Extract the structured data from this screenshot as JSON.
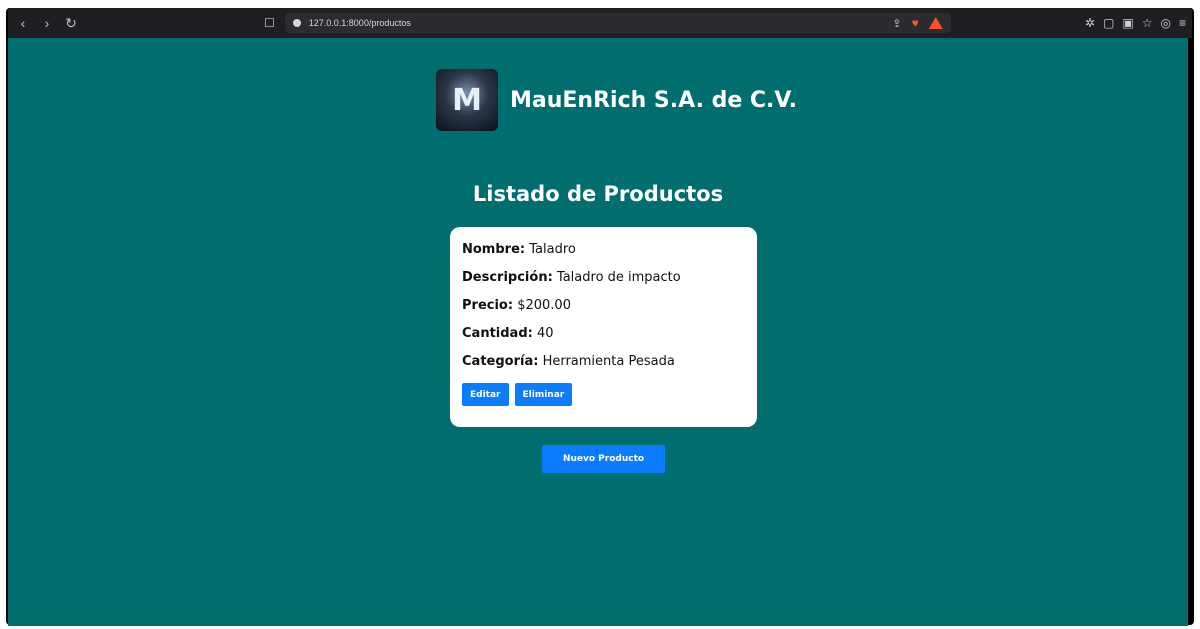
{
  "browser": {
    "url": "127.0.0.1:8000/productos",
    "icons": [
      "back-icon",
      "forward-icon",
      "reload-icon",
      "bookmark-icon",
      "share-icon",
      "brave-shield-icon",
      "rewards-icon",
      "extensions-icon",
      "sidebar-icon",
      "tab-icon",
      "star-icon",
      "vpn-icon",
      "menu-icon"
    ]
  },
  "header": {
    "logo_letter": "M",
    "company_name": "MauEnRich S.A. de C.V."
  },
  "page_title": "Listado de Productos",
  "product": {
    "nombre_label": "Nombre:",
    "nombre": "Taladro",
    "descripcion_label": "Descripción:",
    "descripcion": "Taladro de impacto",
    "precio_label": "Precio:",
    "precio": "$200.00",
    "cantidad_label": "Cantidad:",
    "cantidad": "40",
    "categoria_label": "Categoría:",
    "categoria": "Herramienta Pesada",
    "edit_label": "Editar",
    "delete_label": "Eliminar"
  },
  "new_product_label": "Nuevo Producto",
  "colors": {
    "page_bg": "#006e6e",
    "button": "#0a7cff",
    "card": "#ffffff"
  }
}
